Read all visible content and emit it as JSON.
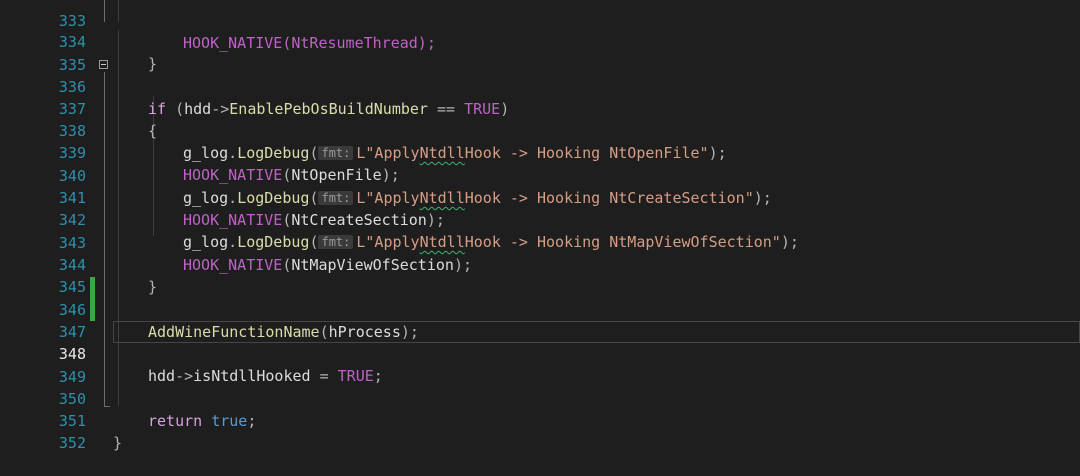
{
  "editor": {
    "lines": [
      {
        "num": "333",
        "partial": "HOOK_NATIVE(NtResumeThread);"
      },
      {
        "num": "334",
        "close": "}"
      },
      {
        "num": "335"
      },
      {
        "num": "336",
        "kw_if": "if",
        "lparen": "(",
        "obj": "hdd",
        "arrow": "->",
        "member": "EnablePebOsBuildNumber",
        "op": " == ",
        "val": "TRUE",
        "rparen": ")"
      },
      {
        "num": "337",
        "open": "{"
      },
      {
        "num": "338",
        "obj": "g_log",
        "dot": ".",
        "fn": "LogDebug",
        "lp": "(",
        "hint": "fmt:",
        "strprefix": "L\"Apply",
        "squig": "Ntdll",
        "strrest": "Hook -> Hooking NtOpenFile\"",
        "end": ");"
      },
      {
        "num": "339",
        "macro": "HOOK_NATIVE",
        "lp": "(",
        "arg": "NtOpenFile",
        "end": ");"
      },
      {
        "num": "340",
        "obj": "g_log",
        "dot": ".",
        "fn": "LogDebug",
        "lp": "(",
        "hint": "fmt:",
        "strprefix": "L\"Apply",
        "squig": "Ntdll",
        "strrest": "Hook -> Hooking NtCreateSection\"",
        "end": ");"
      },
      {
        "num": "341",
        "macro": "HOOK_NATIVE",
        "lp": "(",
        "arg": "NtCreateSection",
        "end": ");"
      },
      {
        "num": "342",
        "obj": "g_log",
        "dot": ".",
        "fn": "LogDebug",
        "lp": "(",
        "hint": "fmt:",
        "strprefix": "L\"Apply",
        "squig": "Ntdll",
        "strrest": "Hook -> Hooking NtMapViewOfSection\"",
        "end": ");"
      },
      {
        "num": "343",
        "macro": "HOOK_NATIVE",
        "lp": "(",
        "arg": "NtMapViewOfSection",
        "end": ");"
      },
      {
        "num": "344",
        "close": "}"
      },
      {
        "num": "345"
      },
      {
        "num": "346",
        "fn": "AddWineFunctionName",
        "lp": "(",
        "arg": "hProcess",
        "end": ");"
      },
      {
        "num": "347"
      },
      {
        "num": "348",
        "obj": "hdd",
        "arrow": "->",
        "member": "isNtdllHooked",
        "op": " = ",
        "val": "TRUE",
        "end": ";"
      },
      {
        "num": "349"
      },
      {
        "num": "350",
        "kw": "return",
        "sp": " ",
        "val": "true",
        "end": ";"
      },
      {
        "num": "351",
        "close": "}"
      },
      {
        "num": "352"
      }
    ],
    "current_line": "348",
    "colors": {
      "background": "#1e1e1e",
      "line_number": "#2b91af",
      "keyword": "#569cd6",
      "macro": "#bd63c5",
      "function": "#dcdcaa",
      "string": "#d69d85",
      "change_bar": "#3fa63f",
      "squiggle": "#3cb371"
    }
  }
}
